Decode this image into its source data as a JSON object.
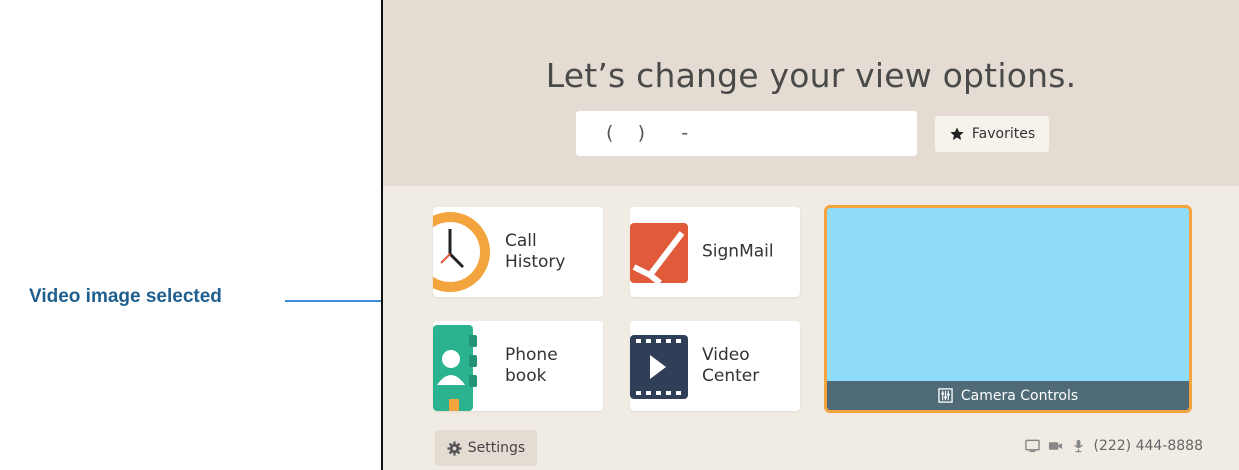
{
  "annotation": {
    "label": "Video image selected"
  },
  "header": {
    "title": "Let’s change your view options.",
    "dial_value": "(    )      -",
    "favorites_label": "Favorites"
  },
  "tiles": {
    "call_history": {
      "line1": "Call",
      "line2": "History",
      "icon": "clock-icon"
    },
    "signmail": {
      "line1": "SignMail",
      "icon": "signmail-icon"
    },
    "phonebook": {
      "line1": "Phone",
      "line2": "book",
      "icon": "phonebook-icon"
    },
    "video_center": {
      "line1": "Video",
      "line2": "Center",
      "icon": "film-icon"
    }
  },
  "video": {
    "camera_controls_label": "Camera Controls",
    "state": "selected"
  },
  "footer": {
    "settings_label": "Settings",
    "phone_number": "(222) 444-8888",
    "status_icons": [
      "screen-icon",
      "camera-icon",
      "microphone-icon"
    ]
  },
  "colors": {
    "header_bg": "#e4dcd2",
    "body_bg": "#f1ece3",
    "selection_border": "#f3a43c",
    "video_bg": "#8edcfa",
    "camera_bar": "#4f6b78",
    "annotation": "#1f5f8e"
  }
}
